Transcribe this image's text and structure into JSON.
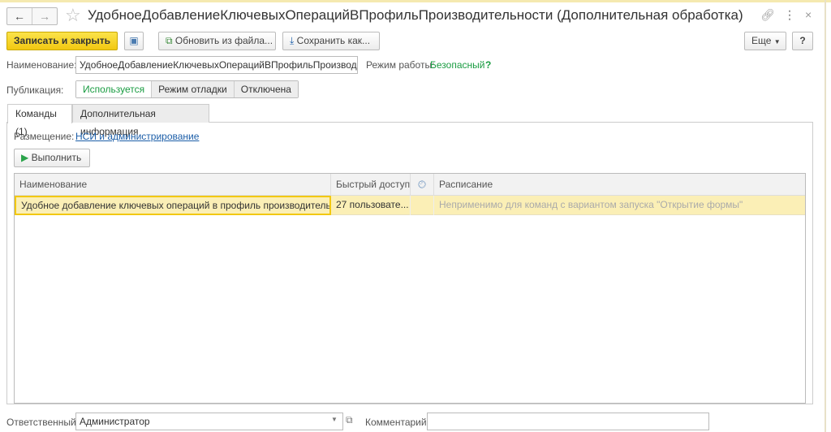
{
  "window": {
    "title": "УдобноеДобавлениеКлючевыхОперацийВПрофильПроизводительности (Дополнительная обработка)"
  },
  "toolbar": {
    "save_close": "Записать и закрыть",
    "update_from_file": "Обновить из файла...",
    "save_as": "Сохранить как...",
    "more": "Еще",
    "help": "?"
  },
  "form": {
    "name_label": "Наименование:",
    "name_value": "УдобноеДобавлениеКлючевыхОперацийВПрофильПроизводительн",
    "mode_label": "Режим работы:",
    "mode_value": "Безопасный",
    "mode_help": "?",
    "publication_label": "Публикация:",
    "publication_options": [
      "Используется",
      "Режим отладки",
      "Отключена"
    ]
  },
  "tabs": [
    {
      "label": "Команды (1)"
    },
    {
      "label": "Дополнительная информация"
    }
  ],
  "commands": {
    "placement_label": "Размещение:",
    "placement_value": "НСИ и администрирование",
    "execute": "Выполнить",
    "columns": [
      "Наименование",
      "Быстрый доступ",
      "",
      "Расписание"
    ],
    "rows": [
      {
        "name": "Удобное добавление ключевых операций в профиль производительности",
        "quick_access": "27 пользовате...",
        "schedule": "Неприменимо для команд с вариантом запуска \"Открытие формы\""
      }
    ]
  },
  "footer": {
    "responsible_label": "Ответственный:",
    "responsible_value": "Администратор",
    "comment_label": "Комментарий:",
    "comment_value": ""
  }
}
